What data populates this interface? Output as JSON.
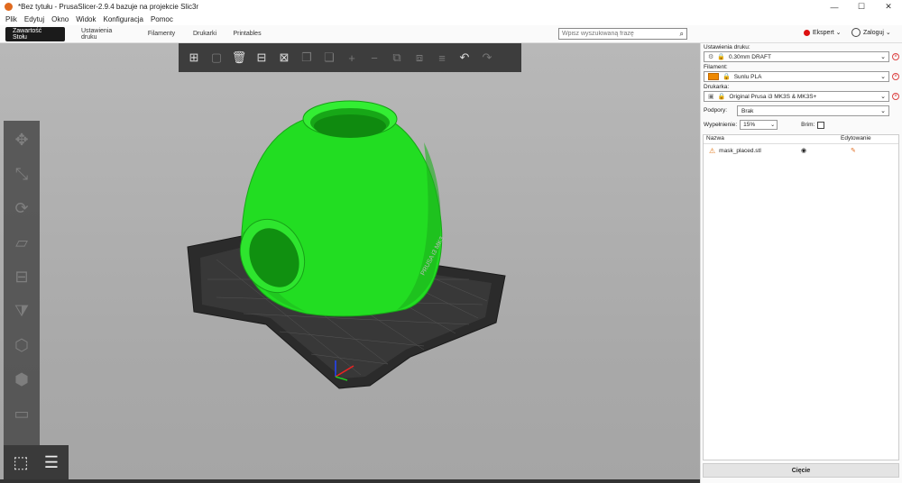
{
  "window": {
    "title": "*Bez tytułu - PrusaSlicer-2.9.4 bazuje na projekcie Slic3r",
    "minimize": "—",
    "maximize": "☐",
    "close": "✕"
  },
  "menu": [
    "Plik",
    "Edytuj",
    "Okno",
    "Widok",
    "Konfiguracja",
    "Pomoc"
  ],
  "tabs": [
    "Zawartość Stołu",
    "Ustawienia druku",
    "Filamenty",
    "Drukarki",
    "Printables"
  ],
  "search": {
    "placeholder": "Wpisz wyszukiwaną frazę"
  },
  "mode": {
    "label": "Ekspert",
    "color": "#dd1111"
  },
  "user": {
    "label": "Zaloguj"
  },
  "panel": {
    "print_label": "Ustawienia druku:",
    "print_value": "0.30mm DRAFT",
    "filament_label": "Filament:",
    "filament_value": "Sunlu PLA",
    "filament_color": "#ee8800",
    "printer_label": "Drukarka:",
    "printer_value": "Original Prusa i3 MK3S & MK3S+",
    "supports_label": "Podpory:",
    "supports_value": "Brak",
    "infill_label": "Wypełnienie:",
    "infill_value": "15%",
    "brim_label": "Brim:",
    "list_col_name": "Nazwa",
    "list_col_edit": "Edytowanie",
    "object_name": "mask_placed.stl",
    "slice_label": "Cięcie"
  },
  "colors": {
    "model": "#22dd22",
    "bed": "#2a2a2a",
    "accent": "#e06a1f"
  }
}
